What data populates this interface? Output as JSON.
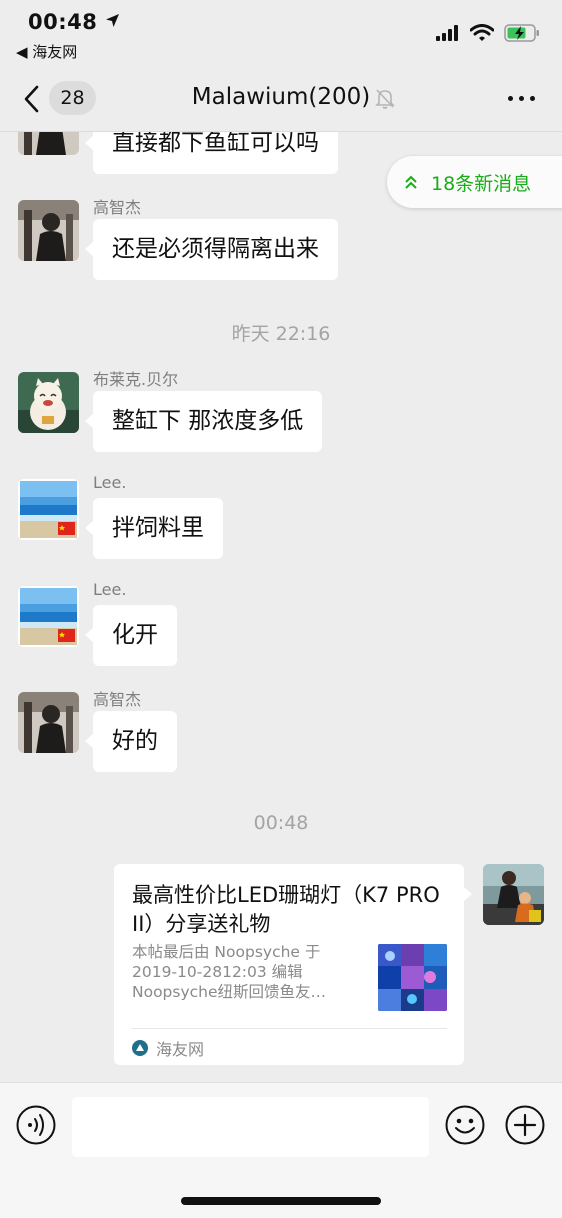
{
  "status_bar": {
    "time": "00:48",
    "back_app": "◀ 海友网"
  },
  "nav": {
    "unread_badge": "28",
    "title": "Malawium(200)"
  },
  "new_messages_pill": "18条新消息",
  "messages": [
    {
      "sender": "",
      "text": "直接都下鱼缸可以吗"
    },
    {
      "sender": "高智杰",
      "text": "还是必须得隔离出来"
    },
    {
      "sender": "布莱克.贝尔",
      "text": "整缸下 那浓度多低"
    },
    {
      "sender": "Lee.",
      "text": "拌饲料里"
    },
    {
      "sender": "Lee.",
      "text": "化开"
    },
    {
      "sender": "高智杰",
      "text": "好的"
    }
  ],
  "timestamps": [
    "昨天 22:16",
    "00:48"
  ],
  "link_card": {
    "title": "最高性价比LED珊瑚灯（K7 PRO II）分享送礼物",
    "desc_lines": [
      "本帖最后由 Noopsyche 于",
      "2019-10-2812:03 编辑",
      "Noopsyche纽斯回馈鱼友…"
    ],
    "source": "海友网"
  },
  "colors": {
    "accent_green": "#1aad19",
    "background": "#ededed",
    "bubble": "#ffffff"
  }
}
